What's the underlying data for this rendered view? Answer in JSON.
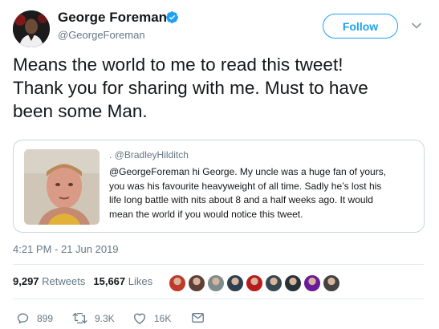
{
  "author": {
    "name": "George Foreman",
    "handle": "@GeorgeForeman",
    "verified": true,
    "follow_label": "Follow"
  },
  "tweet": {
    "lines": [
      "Means the world to me to read this tweet!",
      "Thank you for sharing with me. Must to have",
      "been some Man."
    ],
    "timestamp": "4:21 PM - 21 Jun 2019"
  },
  "quoted": {
    "handle": ". @BradleyHilditch",
    "lines": [
      "@GeorgeForeman hi George. My uncle was a huge fan of yours,",
      "you was his favourite heavyweight of all time. Sadly he’s lost his",
      "life long battle with nits about 8 and a half weeks ago. It would",
      "mean the world if you would notice this tweet."
    ]
  },
  "stats": {
    "retweets_count": "9,297",
    "retweets_label": "Retweets",
    "likes_count": "15,667",
    "likes_label": "Likes"
  },
  "likers": [
    {
      "name": "liker-1",
      "color": "#c0392b"
    },
    {
      "name": "liker-2",
      "color": "#5d4037"
    },
    {
      "name": "liker-3",
      "color": "#7f8c8d"
    },
    {
      "name": "liker-4",
      "color": "#2c3e50"
    },
    {
      "name": "liker-5",
      "color": "#b71c1c"
    },
    {
      "name": "liker-6",
      "color": "#37474f"
    },
    {
      "name": "liker-7",
      "color": "#263238"
    },
    {
      "name": "liker-8",
      "color": "#6a1b9a"
    },
    {
      "name": "liker-9",
      "color": "#424242"
    }
  ],
  "actions": {
    "reply_count": "899",
    "retweet_count": "9.3K",
    "like_count": "16K"
  },
  "colors": {
    "accent": "#1da1f2",
    "muted": "#657786",
    "border": "#ccd6dd"
  },
  "icons": [
    "verified-badge-icon",
    "chevron-down-icon",
    "reply-icon",
    "retweet-icon",
    "like-icon",
    "direct-message-icon"
  ]
}
